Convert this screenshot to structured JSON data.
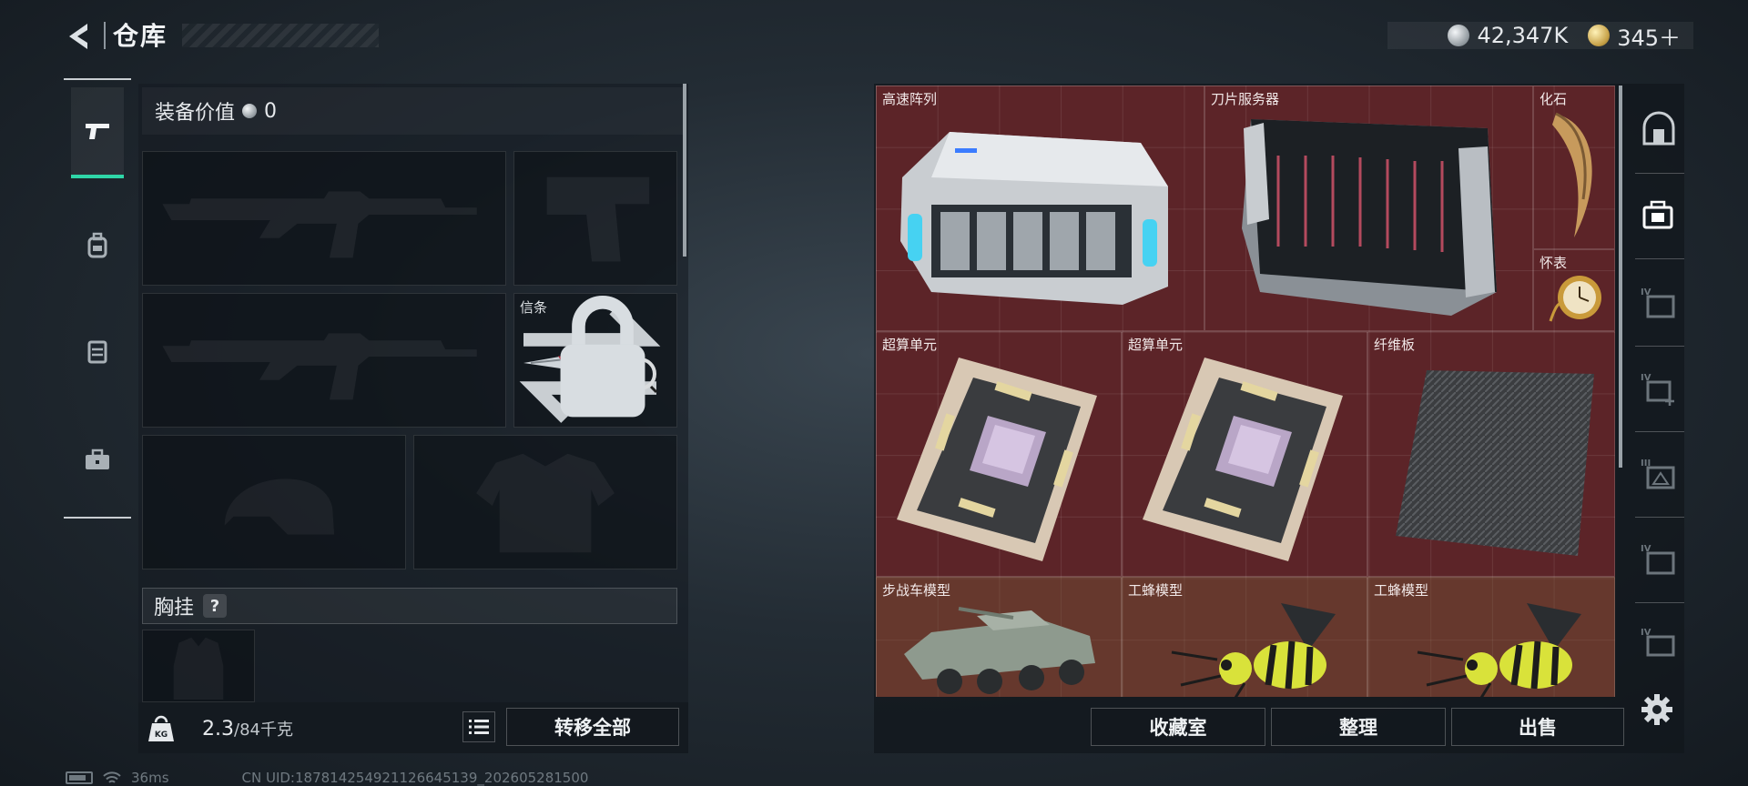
{
  "header": {
    "title": "仓库",
    "currency": [
      {
        "icon": "silver-coin-icon",
        "value": "42,347K"
      },
      {
        "icon": "gold-coin-icon",
        "value": "345＋"
      }
    ]
  },
  "tabs": [
    {
      "name": "pistol-icon",
      "active": true
    },
    {
      "name": "backpack-icon",
      "active": false
    },
    {
      "name": "chest-rig-icon",
      "active": false
    },
    {
      "name": "toolbox-icon",
      "active": false
    }
  ],
  "equipment": {
    "value_label": "装备价值",
    "value": "0",
    "melee_label": "信条",
    "section_label": "胸挂",
    "help": "?",
    "weight": "2.3",
    "weight_max": "/84千克",
    "weight_icon": "KG",
    "transfer_all": "转移全部"
  },
  "storage": {
    "items": [
      {
        "label": "高速阵列"
      },
      {
        "label": "刀片服务器"
      },
      {
        "label": "化石"
      },
      {
        "label": "怀表"
      },
      {
        "label": "超算单元"
      },
      {
        "label": "超算单元"
      },
      {
        "label": "纤维板"
      },
      {
        "label": "步战车模型"
      },
      {
        "label": "工蜂模型"
      },
      {
        "label": "工蜂模型"
      }
    ],
    "collection": "收藏室",
    "sort": "整理",
    "sell": "出售"
  },
  "side_icons": [
    "vault-icon",
    "case-icon",
    "tier-iv-case-icon",
    "tier-iv-add-icon",
    "tier-iii-icon",
    "tier-iv-box-icon",
    "tier-iv-pack-icon",
    "settings-icon"
  ],
  "status": {
    "ping": "36ms",
    "uid": "CN UID:18781425492112664513​9_202605281500"
  }
}
